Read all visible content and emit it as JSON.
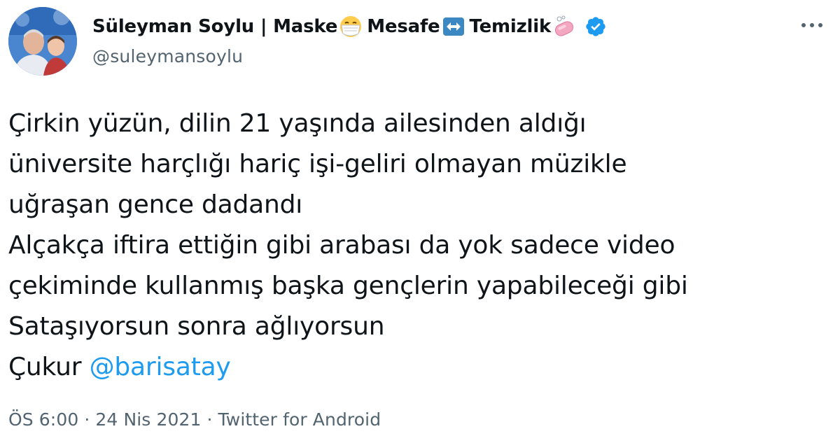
{
  "author": {
    "name_part1": "Süleyman Soylu | Maske",
    "name_part2": "Mesafe",
    "name_part3": "Temizlik",
    "handle": "@suleymansoylu",
    "verified": true,
    "emojis": [
      "face-with-medical-mask-emoji",
      "left-right-arrow-emoji",
      "soap-emoji"
    ]
  },
  "tweet": {
    "lines": [
      "Çirkin yüzün, dilin 21 yaşında ailesinden aldığı",
      "üniversite harçlığı hariç işi-geliri olmayan müzikle",
      "uğraşan gence dadandı",
      "Alçakça iftira ettiğin gibi arabası da yok sadece video",
      "çekiminde kullanmış başka gençlerin yapabileceği gibi",
      "Sataşıyorsun sonra ağlıyorsun",
      "Çukur"
    ],
    "mention": "@barisatay"
  },
  "meta": {
    "time": "ÖS 6:00",
    "separator": "·",
    "date": "24 Nis 2021",
    "source": "Twitter for Android"
  },
  "colors": {
    "link": "#1d9bf0",
    "secondary": "#536471",
    "text": "#0f1419",
    "verified": "#1d9bf0"
  }
}
